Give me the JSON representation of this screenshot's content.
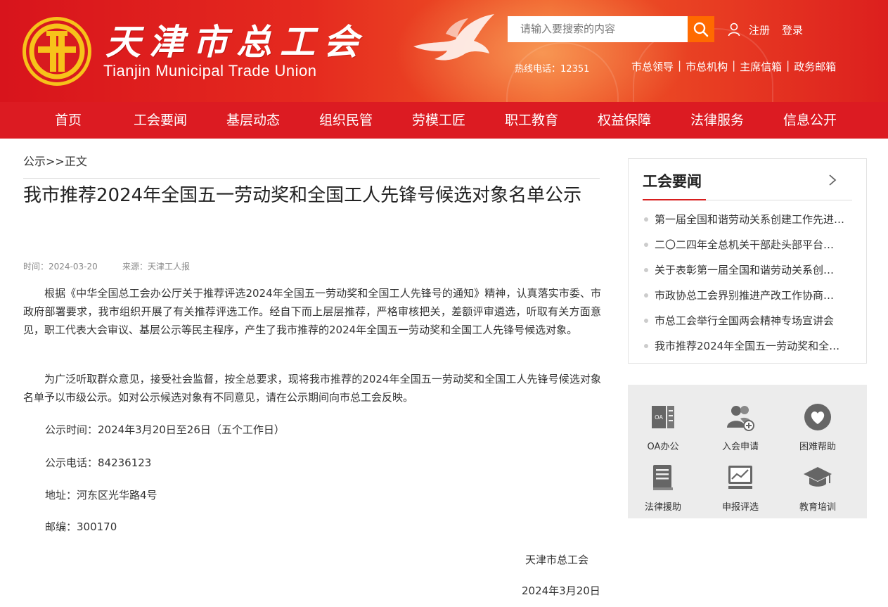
{
  "header": {
    "logo_cn": "天津市总工会",
    "logo_en": "Tianjin Municipal Trade Union",
    "search_placeholder": "请输入要搜索的内容",
    "register": "注册",
    "login": "登录",
    "hotline": "热线电话：12351",
    "quick_links": [
      "市总领导",
      "市总机构",
      "主席信箱",
      "政务邮箱"
    ]
  },
  "nav": [
    "首页",
    "工会要闻",
    "基层动态",
    "组织民管",
    "劳模工匠",
    "职工教育",
    "权益保障",
    "法律服务",
    "信息公开"
  ],
  "breadcrumb": {
    "home": "公示",
    "sep": ">>",
    "current": "正文"
  },
  "article": {
    "title": "我市推荐2024年全国五一劳动奖和全国工人先锋号候选对象名单公示",
    "time": "时间：2024-03-20",
    "source": "来源：天津工人报",
    "paragraphs": [
      "根据《中华全国总工会办公厅关于推荐评选2024年全国五一劳动奖和全国工人先锋号的通知》精神，认真落实市委、市政府部署要求，我市组织开展了有关推荐评选工作。经自下而上层层推荐，严格审核把关，差额评审遴选，听取有关方面意见，职工代表大会审议、基层公示等民主程序，产生了我市推荐的2024年全国五一劳动奖和全国工人先锋号候选对象。",
      "为广泛听取群众意见，接受社会监督，按全总要求，现将我市推荐的2024年全国五一劳动奖和全国工人先锋号候选对象名单予以市级公示。如对公示候选对象有不同意见，请在公示期间向市总工会反映。"
    ],
    "notice_time": "公示时间：2024年3月20日至26日（五个工作日）",
    "notice_phone": "公示电话：84236123",
    "address": "地址：河东区光华路4号",
    "postcode": "邮编：300170",
    "signature": "天津市总工会",
    "date": "2024年3月20日"
  },
  "sidebar": {
    "news_title": "工会要闻",
    "news": [
      "第一届全国和谐劳动关系创建工作先进…",
      "二〇二四年全总机关干部赴头部平台…",
      "关于表彰第一届全国和谐劳动关系创…",
      "市政协总工会界别推进产改工作协商…",
      "市总工会举行全国两会精神专场宣讲会",
      "我市推荐2024年全国五一劳动奖和全…"
    ],
    "services": [
      {
        "label": "OA办公",
        "icon": "oa-icon"
      },
      {
        "label": "入会申请",
        "icon": "join-union-icon"
      },
      {
        "label": "困难帮助",
        "icon": "heart-help-icon"
      },
      {
        "label": "法律援助",
        "icon": "law-book-icon"
      },
      {
        "label": "申报评选",
        "icon": "chart-monitor-icon"
      },
      {
        "label": "教育培训",
        "icon": "graduation-cap-icon"
      }
    ]
  },
  "colors": {
    "brand_red": "#dc1b22",
    "search_orange": "#ff6a00",
    "panel_gray": "#ececec"
  }
}
